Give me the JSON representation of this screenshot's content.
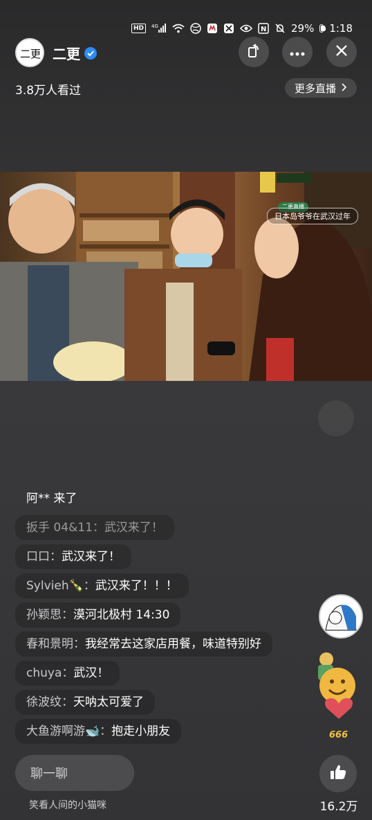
{
  "status_bar": {
    "hd": "HD",
    "net": "4G",
    "nfc": "N",
    "battery_pct": "29%",
    "battery_level": 0.29,
    "time": "1:18"
  },
  "header": {
    "host_name": "二更",
    "avatar_text": "二更",
    "viewers": "3.8万人看过",
    "more_live": "更多直播",
    "icons": [
      "rotate-icon",
      "more-icon",
      "close-icon"
    ]
  },
  "video": {
    "tag": "二更直播",
    "caption": "日本岛爷爷在武汉过年"
  },
  "comments": [
    {
      "user": "阿** 来了",
      "text": "",
      "type": "enter"
    },
    {
      "user": "扳手 04&11：",
      "text": "武汉来了！",
      "type": "fade"
    },
    {
      "user": "口口：",
      "text": "武汉来了！",
      "type": "normal"
    },
    {
      "user": "Sylvieh🍾：",
      "text": "武汉来了！！！",
      "type": "normal"
    },
    {
      "user": "孙颖思：",
      "text": "漠河北极村 14:30",
      "type": "normal"
    },
    {
      "user": "春和景明：",
      "text": "我经常去这家店用餐，味道特别好",
      "type": "normal"
    },
    {
      "user": "chuya：",
      "text": "武汉！",
      "type": "normal"
    },
    {
      "user": "徐波纹：",
      "text": "天呐太可爱了",
      "type": "normal"
    },
    {
      "user": "大鱼游啊游🐋：",
      "text": "抱走小朋友",
      "type": "normal"
    }
  ],
  "side": {
    "emoji_badge": "666"
  },
  "bottom": {
    "chat_placeholder": "聊一聊",
    "cameraman": "笑看人间的小猫咪",
    "like_count": "16.2万"
  },
  "colors": {
    "verified": "#2b8cf2",
    "heart": "#e0505a"
  }
}
